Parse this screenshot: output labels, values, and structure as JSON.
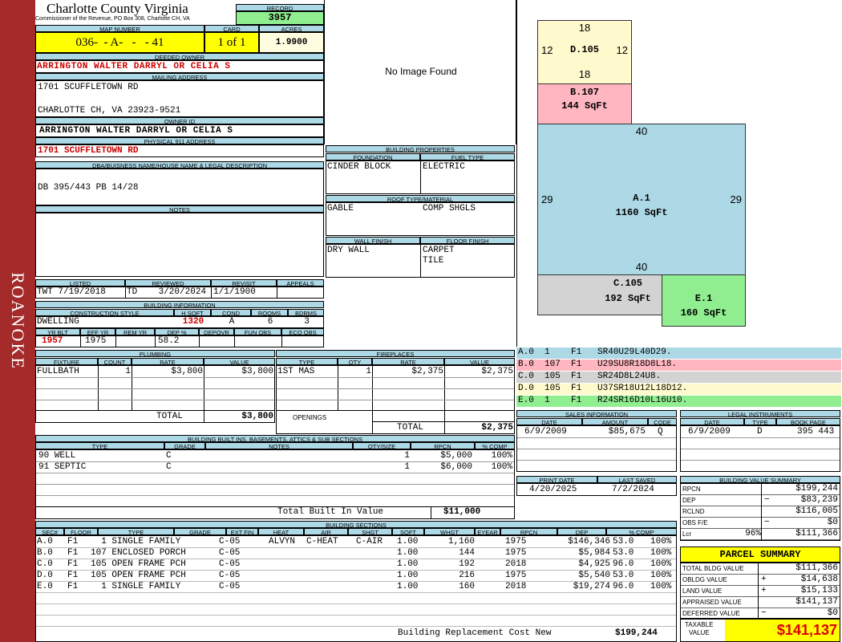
{
  "county": "Charlotte County Virginia",
  "commissioner": "Commissioner of the Revenue, PO Box 308, Charlotte CH, VA",
  "record": {
    "label": "RECORD",
    "value": "3957"
  },
  "map": {
    "label": "MAP NUMBER",
    "value": "036-  - A-   -   - 41"
  },
  "card": {
    "label": "CARD",
    "value": "1 of 1"
  },
  "acres": {
    "label": "ACRES",
    "value": "1.9900"
  },
  "deeded_owner": {
    "label": "DEEDED OWNER",
    "value": "ARRINGTON WALTER DARRYL OR CELIA S"
  },
  "mailing": {
    "label": "MAILING ADDRESS",
    "line1": "1701 SCUFFLETOWN RD",
    "line2": "CHARLOTTE CH, VA 23923-9521"
  },
  "owner_id": {
    "label": "OWNER ID",
    "value": "ARRINGTON WALTER DARRYL OR CELIA S"
  },
  "physical": {
    "label": "PHYSICAL 911 ADDRESS",
    "value": "1701 SCUFFLETOWN RD"
  },
  "legal": {
    "label": "DBA/BUISNESS NAME/HOUSE NAME & LEGAL DESCRIPTION",
    "value": "DB 395/443 PB 14/28"
  },
  "notes": {
    "label": "NOTES"
  },
  "listing": {
    "listed_label": "LISTED",
    "listed": "TWT  7/19/2018",
    "reviewed_label": "REVIEWED",
    "reviewed": "TD    3/20/2024",
    "revisit_label": "REVISIT",
    "revisit": "1/1/1900",
    "appeals_label": "APPEALS"
  },
  "building_info": {
    "label": "BUILDING INFORMATION",
    "h_style": "CONSTRUCTION STYLE",
    "h_hsqft": "H SQFT",
    "h_cond": "COND",
    "h_rooms": "ROOMS",
    "h_bdrms": "BDRMS",
    "style": "DWELLING",
    "hsqft": "1320",
    "cond": "A",
    "rooms": "6",
    "bdrms": "3",
    "h_yrblt": "YR BLT",
    "h_effyr": "EFF YR",
    "h_remyr": "REM YR",
    "h_dep": "DEP %",
    "h_depovr": "DEPOVR",
    "h_funobs": "FUN OBS",
    "h_ecoobs": "ECO OBS",
    "yrblt": "1957",
    "effyr": "1975",
    "dep": "58.2"
  },
  "image_text": "No Image Found",
  "properties": {
    "label": "BUILDING PROPERTIES",
    "foundation_label": "FOUNDATION",
    "foundation": "CINDER BLOCK",
    "fuel_label": "FUEL TYPE",
    "fuel": "ELECTRIC",
    "roof_label": "ROOF TYPE/MATERIAL",
    "roof_type": "GABLE",
    "roof_mat": "COMP SHGLS",
    "wall_label": "WALL FINISH",
    "wall": "DRY WALL",
    "floor_label": "FLOOR FINISH",
    "floor1": "CARPET",
    "floor2": "TILE"
  },
  "sketch": {
    "d105_top": "18",
    "d105_bottom": "18",
    "d105_left": "12",
    "d105_right": "12",
    "d105_label": "D.105",
    "b107_label": "B.107",
    "b107_area": "144 SqFt",
    "a1_top": "40",
    "a1_bottom": "40",
    "a1_left": "29",
    "a1_right": "29",
    "a1_label": "A.1",
    "a1_area": "1160 SqFt",
    "c105_label": "C.105",
    "c105_area": "192 SqFt",
    "e1_label": "E.1",
    "e1_area": "160 SqFt"
  },
  "sketch_codes": [
    {
      "text": "A.0  1    F1   SR40U29L40D29.",
      "color": "#add8e6"
    },
    {
      "text": "B.0  107  F1   U29SU8R18D8L18.",
      "color": "#ffb6c1"
    },
    {
      "text": "C.0  105  F1   SR24D8L24U8.",
      "color": "#d3d3d3"
    },
    {
      "text": "D.0  105  F1   U37SR18U12L18D12.",
      "color": "#fffacd"
    },
    {
      "text": "E.0  1    F1   R24SR16D10L16U10.",
      "color": "#90ee90"
    }
  ],
  "plumbing": {
    "label": "PLUMBING",
    "h_fixture": "FIXTURE",
    "h_count": "COUNT",
    "h_rate": "RATE",
    "h_value": "VALUE",
    "fixture": "FULLBATH",
    "count": "1",
    "rate": "$3,800",
    "value": "$3,800",
    "total_label": "TOTAL",
    "total": "$3,800"
  },
  "fireplaces": {
    "label": "FIREPLACES",
    "h_type": "TYPE",
    "h_qty": "QTY",
    "h_rate": "RATE",
    "h_value": "VALUE",
    "type": "1ST MAS",
    "qty": "1",
    "rate": "$2,375",
    "value": "$2,375",
    "openings_label": "OPENINGS",
    "total_label": "TOTAL",
    "total": "$2,375"
  },
  "sales": {
    "label": "SALES INFORMATION",
    "h_date": "DATE",
    "h_amount": "AMOUNT",
    "h_code": "CODE",
    "date": "6/9/2009",
    "amount": "$85,675",
    "code": "Q"
  },
  "legal_instr": {
    "label": "LEGAL INSTRUMENTS",
    "h_date": "DATE",
    "h_type": "TYPE",
    "h_book": "BOOK PAGE",
    "date": "6/9/2009",
    "type": "D",
    "book": "395 443"
  },
  "builtins": {
    "label": "BUILDING BUILT INS, BASEMENTS, ATTICS & SUB SECTIONS",
    "h_type": "TYPE",
    "h_grade": "GRADE",
    "h_notes": "NOTES",
    "h_qty": "QTY/SIZE",
    "h_rpcn": "RPCN",
    "h_comp": "% COMP",
    "rows": [
      {
        "type": "90 WELL",
        "grade": "C",
        "qty": "1",
        "rpcn": "$5,000",
        "comp": "100%"
      },
      {
        "type": "91 SEPTIC",
        "grade": "C",
        "qty": "1",
        "rpcn": "$6,000",
        "comp": "100%"
      }
    ],
    "total_label": "Total Built In Value",
    "total": "$11,000"
  },
  "print": {
    "print_label": "PRINT DATE",
    "print_date": "4/20/2025",
    "saved_label": "LAST SAVED",
    "saved_date": "7/2/2024"
  },
  "value_summary": {
    "label": "BUILDING VALUE SUMMARY",
    "rows": [
      {
        "k": "RPCN",
        "s": "",
        "v": "$199,244"
      },
      {
        "k": "DEP",
        "s": "−",
        "v": "$83,239"
      },
      {
        "k": "RCLND",
        "s": "",
        "v": "$116,005"
      },
      {
        "k": "OBS F/E",
        "s": "−",
        "v": "$0"
      },
      {
        "k": "Lcr",
        "p": "96%",
        "s": "",
        "v": "$111,366"
      }
    ]
  },
  "parcel": {
    "title": "PARCEL SUMMARY",
    "rows": [
      {
        "k": "TOTAL BLDG VALUE",
        "s": "",
        "v": "$111,366"
      },
      {
        "k": "OBLDG VALUE",
        "s": "+",
        "v": "$14,638"
      },
      {
        "k": "LAND VALUE",
        "s": "+",
        "v": "$15,133"
      },
      {
        "k": "APPRAISED VALUE",
        "s": "",
        "v": "$141,137"
      },
      {
        "k": "DEFERRED VALUE",
        "s": "−",
        "v": "$0"
      }
    ],
    "taxable_label1": "TAXABLE",
    "taxable_label2": "VALUE",
    "taxable": "$141,137"
  },
  "sections": {
    "label": "BUILDING SECTIONS",
    "headers": [
      "SEC#",
      "FLOOR",
      "TYPE",
      "GRADE",
      "EXT FIN",
      "HEAT",
      "AIR",
      "SHGT",
      "SQFT",
      "WHGT",
      "EYEAR",
      "RPCN",
      "DEP",
      "% COMP"
    ],
    "rows": [
      {
        "sec": "A.0",
        "floor": "F1",
        "type": "  1 SINGLE FAMILY",
        "grade": "C-05",
        "ext": "ALVYN",
        "heat": "C-HEAT",
        "air": "C-AIR",
        "shgt": "1.00",
        "sqft": "1,160",
        "eyear": "1975",
        "rpcn": "$146,346",
        "dep": "53.0",
        "comp": "100%"
      },
      {
        "sec": "B.0",
        "floor": "F1",
        "type": "107 ENCLOSED PORCH",
        "grade": "C-05",
        "ext": "",
        "heat": "",
        "air": "",
        "shgt": "1.00",
        "sqft": "144",
        "eyear": "1975",
        "rpcn": "$5,984",
        "dep": "53.0",
        "comp": "100%"
      },
      {
        "sec": "C.0",
        "floor": "F1",
        "type": "105 OPEN FRAME PCH",
        "grade": "C-05",
        "ext": "",
        "heat": "",
        "air": "",
        "shgt": "1.00",
        "sqft": "192",
        "eyear": "2018",
        "rpcn": "$4,925",
        "dep": "96.0",
        "comp": "100%"
      },
      {
        "sec": "D.0",
        "floor": "F1",
        "type": "105 OPEN FRAME PCH",
        "grade": "C-05",
        "ext": "",
        "heat": "",
        "air": "",
        "shgt": "1.00",
        "sqft": "216",
        "eyear": "1975",
        "rpcn": "$5,540",
        "dep": "53.0",
        "comp": "100%"
      },
      {
        "sec": "E.0",
        "floor": "F1",
        "type": "  1 SINGLE FAMILY",
        "grade": "C-05",
        "ext": "",
        "heat": "",
        "air": "",
        "shgt": "1.00",
        "sqft": "160",
        "eyear": "2018",
        "rpcn": "$19,274",
        "dep": "96.0",
        "comp": "100%"
      }
    ],
    "total_label": "Building Replacement Cost New",
    "total": "$199,244"
  },
  "roanoke": "ROANOKE"
}
